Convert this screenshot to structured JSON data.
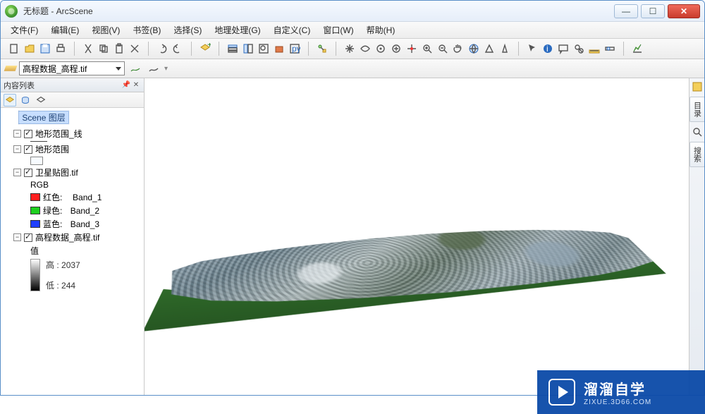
{
  "window": {
    "title": "无标题 - ArcScene",
    "min": "—",
    "max": "☐",
    "close": "✕"
  },
  "menubar": [
    "文件(F)",
    "编辑(E)",
    "视图(V)",
    "书签(B)",
    "选择(S)",
    "地理处理(G)",
    "自定义(C)",
    "窗口(W)",
    "帮助(H)"
  ],
  "layer_combo": "高程数据_高程.tif",
  "toc": {
    "title": "内容列表",
    "pin": "📌",
    "close": "✕",
    "scene": "Scene 图层",
    "layers": [
      {
        "name": "地形范围_线",
        "checked": true,
        "symType": "line"
      },
      {
        "name": "地形范围",
        "checked": true,
        "symType": "box"
      },
      {
        "name": "卫星贴图.tif",
        "checked": true,
        "rgb": {
          "label": "RGB",
          "bands": [
            {
              "color": "#ff1f1f",
              "label": "红色:",
              "value": "Band_1"
            },
            {
              "color": "#1fcf1f",
              "label": "绿色:",
              "value": "Band_2"
            },
            {
              "color": "#1f3fff",
              "label": "蓝色:",
              "value": "Band_3"
            }
          ]
        }
      },
      {
        "name": "高程数据_高程.tif",
        "checked": true,
        "stretch": {
          "label": "值",
          "high_label": "高 :",
          "high": "2037",
          "low_label": "低 :",
          "low": "244"
        }
      }
    ]
  },
  "right_dock": {
    "tab1": "目录",
    "tab2": "搜索"
  },
  "watermark": {
    "big": "溜溜自学",
    "small": "ZIXUE.3D66.COM"
  }
}
